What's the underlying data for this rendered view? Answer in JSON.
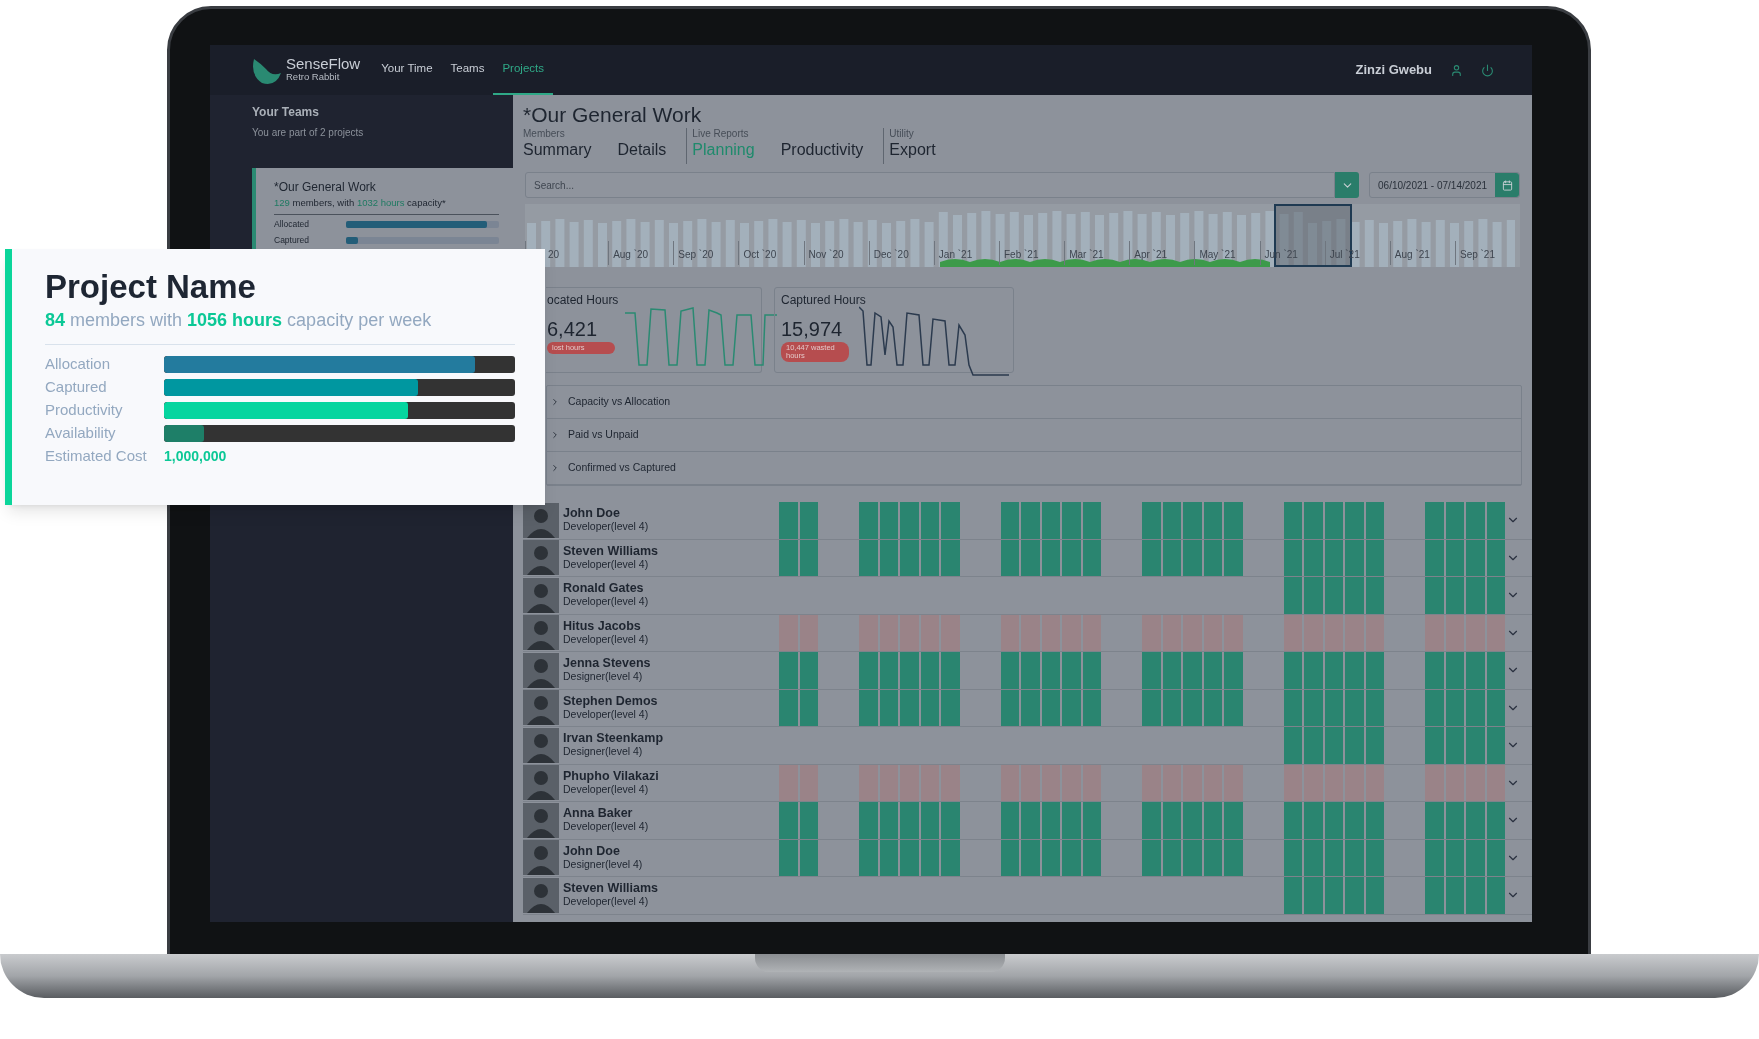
{
  "nav": {
    "brand": "SenseFlow",
    "subtitle": "Retro Rabbit",
    "links": [
      {
        "label": "Your Time",
        "selected": false
      },
      {
        "label": "Teams",
        "selected": false
      },
      {
        "label": "Projects",
        "selected": true
      }
    ],
    "user": "Zinzi Gwebu"
  },
  "sidebar": {
    "title": "Your Teams",
    "subtitle": "You are part of 2 projects",
    "team": {
      "name": "*Our General Work",
      "summary": [
        {
          "text": "129",
          "highlight": true
        },
        {
          "text": " members, with ",
          "highlight": false
        },
        {
          "text": "1032 hours",
          "highlight": true
        },
        {
          "text": " capacity*",
          "highlight": false
        }
      ],
      "bars": [
        {
          "label": "Allocated",
          "level": 0.92
        },
        {
          "label": "Captured",
          "level": 0.08
        }
      ]
    }
  },
  "project_card": {
    "title": "Project Name",
    "summary": [
      {
        "text": "84",
        "highlight": true
      },
      {
        "text": " members with ",
        "highlight": false
      },
      {
        "text": "1056 hours",
        "highlight": true
      },
      {
        "text": " capacity per week",
        "highlight": false
      }
    ],
    "metrics": [
      {
        "label": "Allocation",
        "level": 0.885,
        "color": "#237b9e"
      },
      {
        "label": "Captured",
        "level": 0.725,
        "color": "#0097a0"
      },
      {
        "label": "Productivity",
        "level": 0.695,
        "color": "#05d59f"
      },
      {
        "label": "Availability",
        "level": 0.115,
        "color": "#1e7f68"
      }
    ],
    "cost": {
      "label": "Estimated Cost",
      "value": "1,000,000"
    }
  },
  "main": {
    "title": "*Our General Work",
    "tab_groups": [
      {
        "caption": "Members",
        "tabs": [
          {
            "label": "Summary",
            "selected": false
          },
          {
            "label": "Details",
            "selected": false
          }
        ]
      },
      {
        "caption": "Live Reports",
        "tabs": [
          {
            "label": "Planning",
            "selected": true
          },
          {
            "label": "Productivity",
            "selected": false
          }
        ]
      },
      {
        "caption": "Utility",
        "tabs": [
          {
            "label": "Export",
            "selected": false
          }
        ]
      }
    ],
    "search": {
      "placeholder": "Search..."
    },
    "date_range": "06/10/2021 - 07/14/2021",
    "timeline": {
      "months": [
        "20",
        "Aug `20",
        "Sep `20",
        "Oct `20",
        "Nov `20",
        "Dec `20",
        "Jan `21",
        "Feb `21",
        "Mar `21",
        "Apr `21",
        "May `21",
        "Jun `21",
        "Jul `21",
        "Aug `21",
        "Sep `21"
      ]
    },
    "stats": [
      {
        "kind": "allocated",
        "title": "ocated Hours",
        "value": "6,421",
        "badge": "lost hours"
      },
      {
        "kind": "captured",
        "title": "Captured Hours",
        "value": "15,974",
        "badge": "10,447 wasted hours"
      }
    ],
    "sections": [
      {
        "label": "Capacity vs Allocation",
        "expanded": false
      },
      {
        "label": "Paid vs Unpaid",
        "expanded": false
      },
      {
        "label": "Confirmed vs Captured",
        "expanded": false
      }
    ],
    "members": [
      {
        "name": "John Doe",
        "role": "Developer(level 4)",
        "kind": "full"
      },
      {
        "name": "Steven Williams",
        "role": "Developer(level 4)",
        "kind": "full"
      },
      {
        "name": "Ronald Gates",
        "role": "Developer(level 4)",
        "kind": "partial"
      },
      {
        "name": "Hitus Jacobs",
        "role": "Developer(level 4)",
        "kind": "unavailable"
      },
      {
        "name": "Jenna Stevens",
        "role": "Designer(level 4)",
        "kind": "full"
      },
      {
        "name": "Stephen Demos",
        "role": "Developer(level 4)",
        "kind": "full"
      },
      {
        "name": "Irvan Steenkamp",
        "role": "Designer(level 4)",
        "kind": "partial"
      },
      {
        "name": "Phupho Vilakazi",
        "role": "Developer(level 4)",
        "kind": "unavailable"
      },
      {
        "name": "Anna Baker",
        "role": "Developer(level 4)",
        "kind": "full"
      },
      {
        "name": "John Doe",
        "role": "Designer(level 4)",
        "kind": "full"
      },
      {
        "name": "Steven Williams",
        "role": "Developer(level 4)",
        "kind": "partial"
      }
    ]
  }
}
